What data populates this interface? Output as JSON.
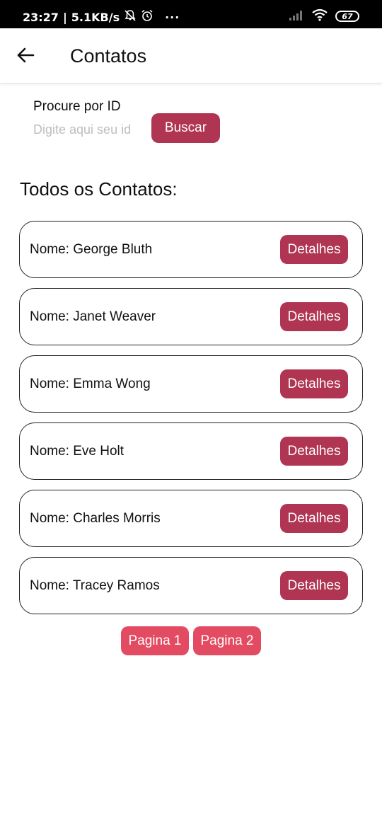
{
  "status_bar": {
    "time": "23:27",
    "network_speed": "5.1KB/s",
    "overflow": "···",
    "battery": "67",
    "icons": [
      "mute-bell-icon",
      "alarm-icon",
      "signal-icon",
      "wifi-icon",
      "battery-icon"
    ]
  },
  "app_bar": {
    "title": "Contatos",
    "back_icon": "arrow-back-icon"
  },
  "search": {
    "label": "Procure por ID",
    "placeholder": "Digite aqui seu id",
    "value": "",
    "button_label": "Buscar"
  },
  "section_title": "Todos os Contatos:",
  "contacts": [
    {
      "name": "Nome: George Bluth",
      "button": "Detalhes"
    },
    {
      "name": "Nome: Janet Weaver",
      "button": "Detalhes"
    },
    {
      "name": "Nome: Emma Wong",
      "button": "Detalhes"
    },
    {
      "name": "Nome: Eve Holt",
      "button": "Detalhes"
    },
    {
      "name": "Nome: Charles Morris",
      "button": "Detalhes"
    },
    {
      "name": "Nome: Tracey Ramos",
      "button": "Detalhes"
    }
  ],
  "pagination": {
    "pages": [
      "Pagina 1",
      "Pagina 2"
    ]
  },
  "colors": {
    "primary_button": "#b03553",
    "page_button": "#e24b62"
  }
}
